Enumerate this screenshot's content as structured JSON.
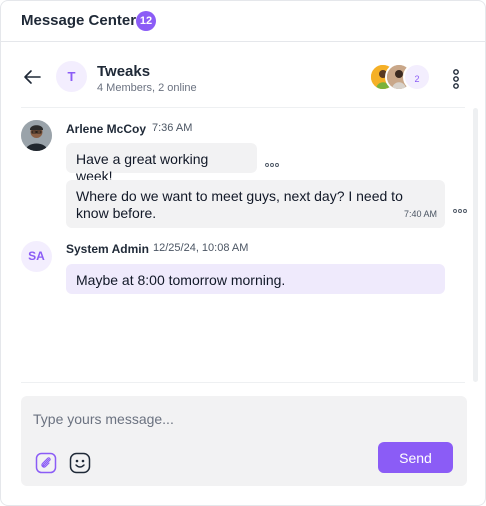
{
  "app": {
    "title": "Message Center",
    "unread_count": "12"
  },
  "chat": {
    "group_initial": "T",
    "group_name": "Tweaks",
    "group_meta": "4 Members, 2 online",
    "extra_members": "2"
  },
  "messages": [
    {
      "sender": "Arlene McCoy",
      "time": "7:36 AM",
      "bubbles": [
        {
          "text": "Have a great working week!"
        },
        {
          "text": "Where do we want to meet guys, next day? I need to know before.",
          "time": "7:40 AM"
        }
      ]
    },
    {
      "sender_initials": "SA",
      "sender": "System Admin",
      "time": "12/25/24, 10:08 AM",
      "bubbles": [
        {
          "text": "Maybe at 8:00 tomorrow morning."
        }
      ]
    }
  ],
  "composer": {
    "placeholder": "Type yours message...",
    "value": "",
    "send_label": "Send"
  },
  "colors": {
    "accent": "#8b5cf6",
    "accent_soft": "#f3eefe",
    "bubble": "#f2f2f3",
    "bubble_self": "#efeafc"
  },
  "icons": [
    "arrow-left-icon",
    "more-vertical-icon",
    "more-horizontal-icon",
    "attachment-icon",
    "emoji-icon"
  ]
}
